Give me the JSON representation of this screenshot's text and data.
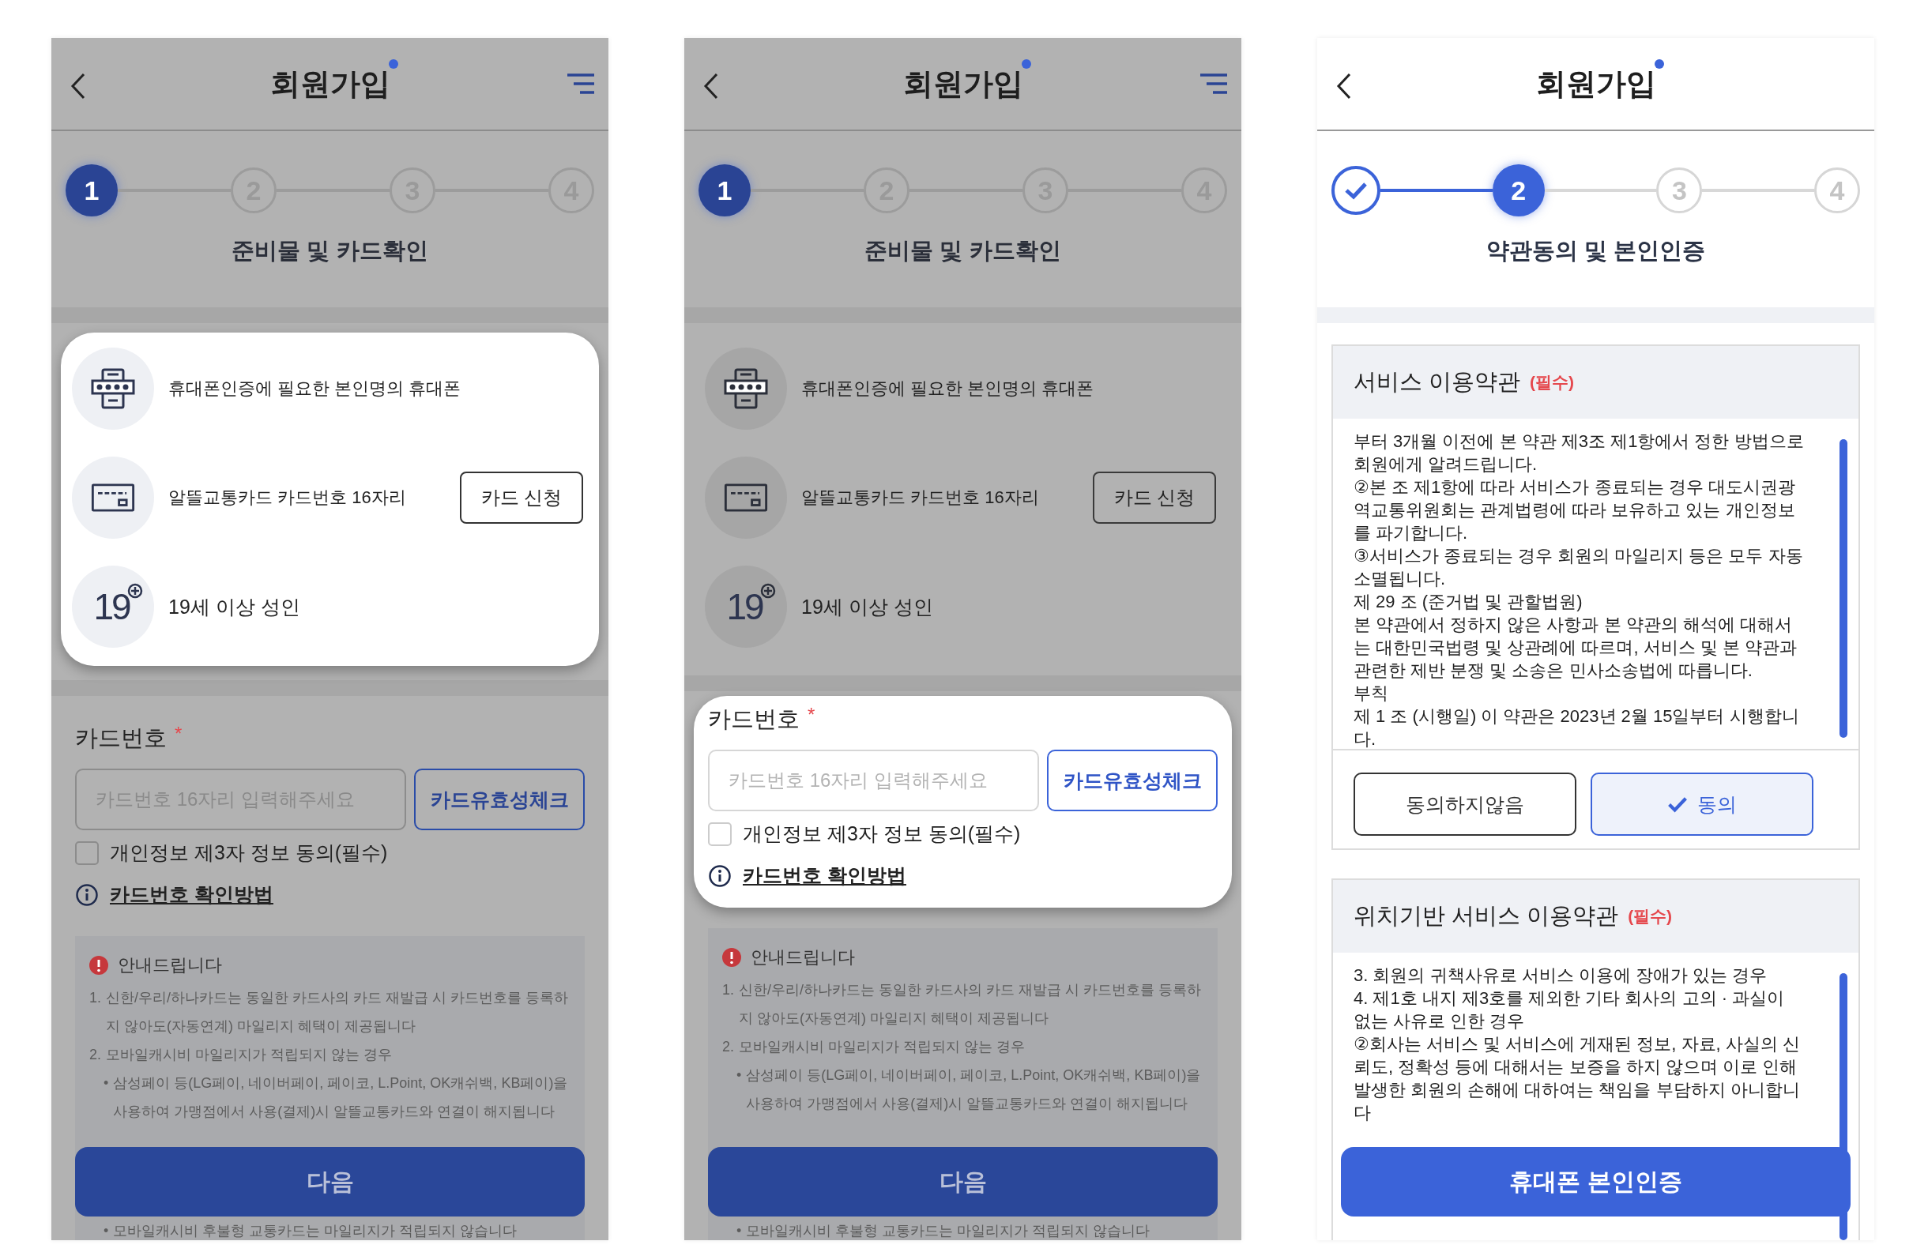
{
  "screens": [
    {
      "dimmed": true,
      "title": "회원가입",
      "menu": true,
      "steps": [
        {
          "label": "1",
          "selected": true,
          "done": false
        },
        {
          "label": "2",
          "selected": false,
          "done": false
        },
        {
          "label": "3",
          "selected": false,
          "done": false
        },
        {
          "label": "4",
          "selected": false,
          "done": false
        }
      ],
      "step_title": "준비물 및 카드확인",
      "requirements": {
        "highlighted": true,
        "items": [
          {
            "kind": "keypad",
            "text": "휴대폰인증에 필요한 본인명의 휴대폰"
          },
          {
            "kind": "card",
            "text": "알뜰교통카드 카드번호 16자리",
            "button": "카드 신청"
          },
          {
            "kind": "age",
            "badge": "19",
            "text": "19세 이상 성인"
          }
        ]
      },
      "form": {
        "highlighted": false,
        "label": "카드번호",
        "required": "*",
        "placeholder": "카드번호 16자리 입력해주세요",
        "check_button": "카드유효성체크",
        "consent": {
          "label": "개인정보 제3자 정보 동의(필수)",
          "checked": false
        },
        "help_link": "카드번호 확인방법"
      },
      "notice": {
        "title": "안내드립니다",
        "lines": [
          {
            "kind": "numbered",
            "marker": "1.",
            "text": "신한/우리/하나카드는 동일한 카드사의 카드 재발급 시 카드번호를 등록하지 않아도(자동연계) 마일리지 혜택이 제공됩니다"
          },
          {
            "kind": "numbered",
            "marker": "2.",
            "text": "모바일캐시비 마일리지가 적립되지 않는 경우"
          },
          {
            "kind": "bullet",
            "marker": "•",
            "text": "삼성페이 등(LG페이, 네이버페이, 페이코, L.Point, OK캐쉬백, KB페이)을 사용하여 가맹점에서 사용(결제)시 알뜰교통카드와 연결이 해지됩니다"
          },
          {
            "kind": "bullet",
            "marker": "•",
            "text": "모바일캐시비 후불형 교통카드는 마일리지가 적립되지 않습니다"
          }
        ]
      },
      "action": "다음"
    },
    {
      "dimmed": true,
      "title": "회원가입",
      "menu": true,
      "steps": [
        {
          "label": "1",
          "selected": true,
          "done": false
        },
        {
          "label": "2",
          "selected": false,
          "done": false
        },
        {
          "label": "3",
          "selected": false,
          "done": false
        },
        {
          "label": "4",
          "selected": false,
          "done": false
        }
      ],
      "step_title": "준비물 및 카드확인",
      "requirements": {
        "highlighted": false,
        "items": [
          {
            "kind": "keypad",
            "text": "휴대폰인증에 필요한 본인명의 휴대폰"
          },
          {
            "kind": "card",
            "text": "알뜰교통카드 카드번호 16자리",
            "button": "카드 신청"
          },
          {
            "kind": "age",
            "badge": "19",
            "text": "19세 이상 성인"
          }
        ]
      },
      "form": {
        "highlighted": true,
        "label": "카드번호",
        "required": "*",
        "placeholder": "카드번호 16자리 입력해주세요",
        "check_button": "카드유효성체크",
        "consent": {
          "label": "개인정보 제3자 정보 동의(필수)",
          "checked": false
        },
        "help_link": "카드번호 확인방법"
      },
      "notice": {
        "title": "안내드립니다",
        "lines": [
          {
            "kind": "numbered",
            "marker": "1.",
            "text": "신한/우리/하나카드는 동일한 카드사의 카드 재발급 시 카드번호를 등록하지 않아도(자동연계) 마일리지 혜택이 제공됩니다"
          },
          {
            "kind": "numbered",
            "marker": "2.",
            "text": "모바일캐시비 마일리지가 적립되지 않는 경우"
          },
          {
            "kind": "bullet",
            "marker": "•",
            "text": "삼성페이 등(LG페이, 네이버페이, 페이코, L.Point, OK캐쉬백, KB페이)을 사용하여 가맹점에서 사용(결제)시 알뜰교통카드와 연결이 해지됩니다"
          },
          {
            "kind": "bullet",
            "marker": "•",
            "text": "모바일캐시비 후불형 교통카드는 마일리지가 적립되지 않습니다"
          }
        ]
      },
      "action": "다음"
    },
    {
      "dimmed": false,
      "title": "회원가입",
      "menu": false,
      "steps": [
        {
          "selected": false,
          "done": true
        },
        {
          "label": "2",
          "selected": true,
          "done": false
        },
        {
          "label": "3",
          "selected": false,
          "done": false
        },
        {
          "label": "4",
          "selected": false,
          "done": false
        }
      ],
      "step_title": "약관동의 및 본인인증",
      "terms": [
        {
          "title": "서비스 이용약관",
          "tag": "(필수)",
          "body": [
            "부터 3개월 이전에 본 약관 제3조 제1항에서 정한 방법으로 회원에게 알려드립니다.",
            "②본 조 제1항에 따라 서비스가 종료되는 경우 대도시권광역교통위원회는 관계법령에 따라 보유하고 있는 개인정보를 파기합니다.",
            "③서비스가 종료되는 경우 회원의 마일리지 등은 모두 자동 소멸됩니다.",
            "제 29 조 (준거법 및 관할법원)",
            "본 약관에서 정하지 않은 사항과 본 약관의 해석에 대해서는 대한민국법령 및 상관례에 따르며, 서비스 및 본 약관과 관련한 제반 분쟁 및 소송은 민사소송법에 따릅니다.",
            "부칙",
            "제 1 조 (시행일) 이 약관은 2023년 2월 15일부터 시행합니다."
          ],
          "buttons": [
            {
              "label": "동의하지않음",
              "selected": false
            },
            {
              "label": "동의",
              "selected": true
            }
          ]
        },
        {
          "title": "위치기반 서비스 이용약관",
          "tag": "(필수)",
          "body": [
            "3. 회원의 귀책사유로 서비스 이용에 장애가 있는 경우",
            "4. 제1호 내지 제3호를 제외한 기타 회사의 고의 · 과실이 없는 사유로 인한 경우",
            "②회사는 서비스 및 서비스에 게재된 정보, 자료, 사실의 신뢰도, 정확성 등에 대해서는 보증을 하지 않으며 이로 인해 발생한 회원의 손해에 대하여는 책임을 부담하지 아니합니다"
          ]
        }
      ],
      "action": "휴대폰 본인인증"
    }
  ]
}
